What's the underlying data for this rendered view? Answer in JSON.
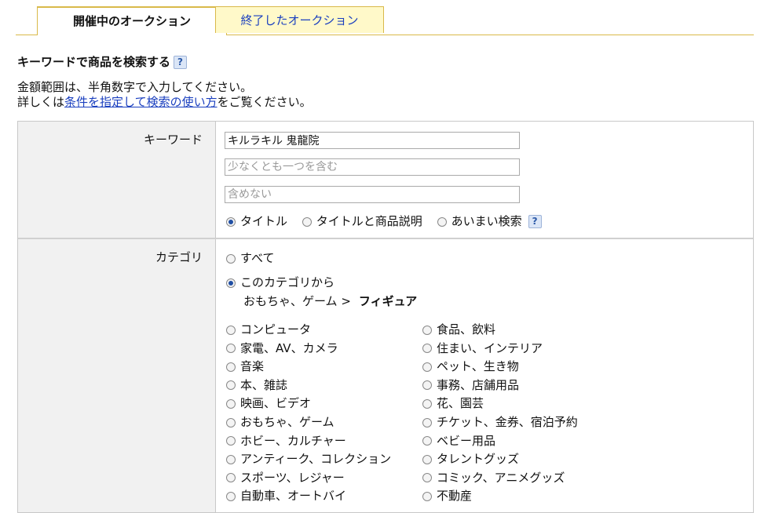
{
  "tabs": {
    "active": "開催中のオークション",
    "inactive": "終了したオークション"
  },
  "section": {
    "title": "キーワードで商品を検索する",
    "help": "?"
  },
  "note": {
    "line1": "金額範囲は、半角数字で入力してください。",
    "line2_prefix": "詳しくは",
    "line2_link": "条件を指定して検索の使い方",
    "line2_suffix": "をご覧ください。"
  },
  "keyword": {
    "label": "キーワード",
    "value": "キルラキル 鬼龍院",
    "include_placeholder": "少なくとも一つを含む",
    "exclude_placeholder": "含めない",
    "search_options": [
      "タイトル",
      "タイトルと商品説明",
      "あいまい検索"
    ],
    "help": "?"
  },
  "category": {
    "label": "カテゴリ",
    "all": "すべて",
    "from_this": "このカテゴリから",
    "path_parent": "おもちゃ、ゲーム >",
    "path_current": "フィギュア",
    "left_items": [
      "コンピュータ",
      "家電、AV、カメラ",
      "音楽",
      "本、雑誌",
      "映画、ビデオ",
      "おもちゃ、ゲーム",
      "ホビー、カルチャー",
      "アンティーク、コレクション",
      "スポーツ、レジャー",
      "自動車、オートバイ"
    ],
    "right_items": [
      "食品、飲料",
      "住まい、インテリア",
      "ペット、生き物",
      "事務、店舗用品",
      "花、園芸",
      "チケット、金券、宿泊予約",
      "ベビー用品",
      "タレントグッズ",
      "コミック、アニメグッズ",
      "不動産"
    ]
  }
}
